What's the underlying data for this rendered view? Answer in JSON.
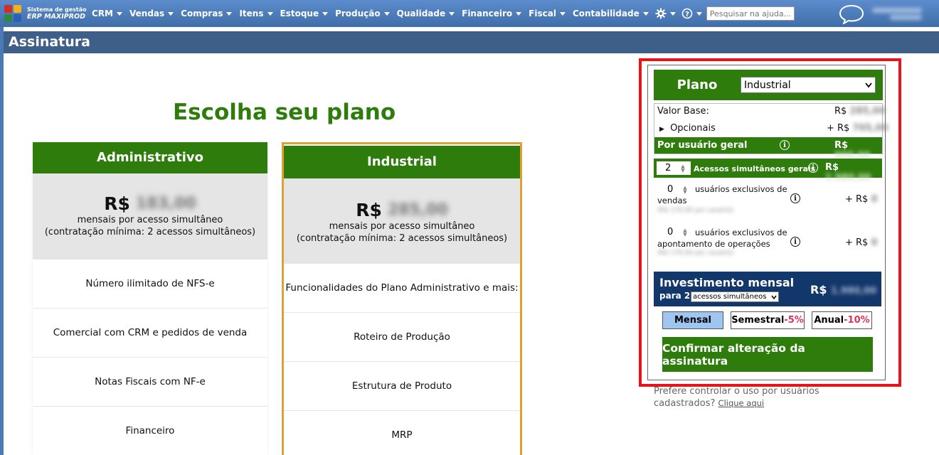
{
  "topbar": {
    "logo_line1": "Sistema de gestão",
    "logo_line2": "ERP MAXIPROD",
    "menu": [
      "CRM",
      "Vendas",
      "Compras",
      "Itens",
      "Estoque",
      "Produção",
      "Qualidade",
      "Financeiro",
      "Fiscal",
      "Contabilidade"
    ],
    "search_placeholder": "Pesquisar na ajuda..."
  },
  "page": {
    "title": "Assinatura",
    "heading": "Escolha seu plano"
  },
  "plans": [
    {
      "name": "Administrativo",
      "currency": "R$",
      "price_hidden": "183,00",
      "per": "mensais por acesso simultâneo",
      "min": "(contratação mínima: 2 acessos simultâneos)",
      "features": [
        "Número ilimitado de NFS-e",
        "Comercial com CRM e pedidos de venda",
        "Notas Fiscais com NF-e",
        "Financeiro"
      ]
    },
    {
      "name": "Industrial",
      "currency": "R$",
      "price_hidden": "285,00",
      "per": "mensais por acesso simultâneo",
      "min": "(contratação mínima: 2 acessos simultâneos)",
      "features": [
        "Funcionalidades do Plano Administrativo e mais:",
        "Roteiro de Produção",
        "Estrutura de Produto",
        "MRP"
      ]
    }
  ],
  "panel": {
    "plan_label": "Plano",
    "plan_selected": "Industrial",
    "valor_base_label": "Valor Base:",
    "valor_base_cur": "R$",
    "valor_base_hidden": "285,00",
    "opcionais_label": "Opcionais",
    "opcionais_cur": "+ R$",
    "opcionais_hidden": "705,00",
    "por_usuario_label": "Por usuário geral",
    "por_usuario_cur": "R$",
    "por_usuario_hidden": "990,00",
    "acessos_value": "2",
    "acessos_label": "Acessos simultâneos gerais",
    "acessos_cur": "R$",
    "acessos_hidden": "1.980,00",
    "exclusivos_vendas_value": "0",
    "exclusivos_vendas_label_1": "usuários exclusivos de",
    "exclusivos_vendas_label_2": "vendas",
    "exclusivos_vendas_hint": "(R$ 170,00 por usuário)",
    "exclusivos_vendas_cur": "+ R$",
    "exclusivos_vendas_hidden": "0",
    "exclusivos_op_value": "0",
    "exclusivos_op_label_1": "usuários exclusivos de",
    "exclusivos_op_label_2": "apontamento de operações",
    "exclusivos_op_hint": "(R$ 170,00 por usuário)",
    "exclusivos_op_cur": "+ R$",
    "exclusivos_op_hidden": "0",
    "invest_title": "Investimento mensal",
    "invest_para": "para 2",
    "invest_select": "acessos simultâneos",
    "invest_cur": "R$",
    "invest_hidden": "1.980,00",
    "period_mensal": "Mensal",
    "period_semestral": "Semestral",
    "period_semestral_disc": "-5%",
    "period_anual": "Anual",
    "period_anual_disc": "-10%",
    "confirm_label": "Confirmar alteração da assinatura",
    "pref_text": "Prefere controlar o uso por usuários cadastrados?",
    "pref_link": "Clique aqui"
  },
  "colors": {
    "brand_green": "#2e7d0c",
    "nav_blue": "#4a7ab5",
    "title_blue": "#3e5f87",
    "invest_navy": "#12376b",
    "highlight_red": "#e8141a",
    "card_border_gold": "#dca238",
    "discount_pink": "#e0325a"
  }
}
